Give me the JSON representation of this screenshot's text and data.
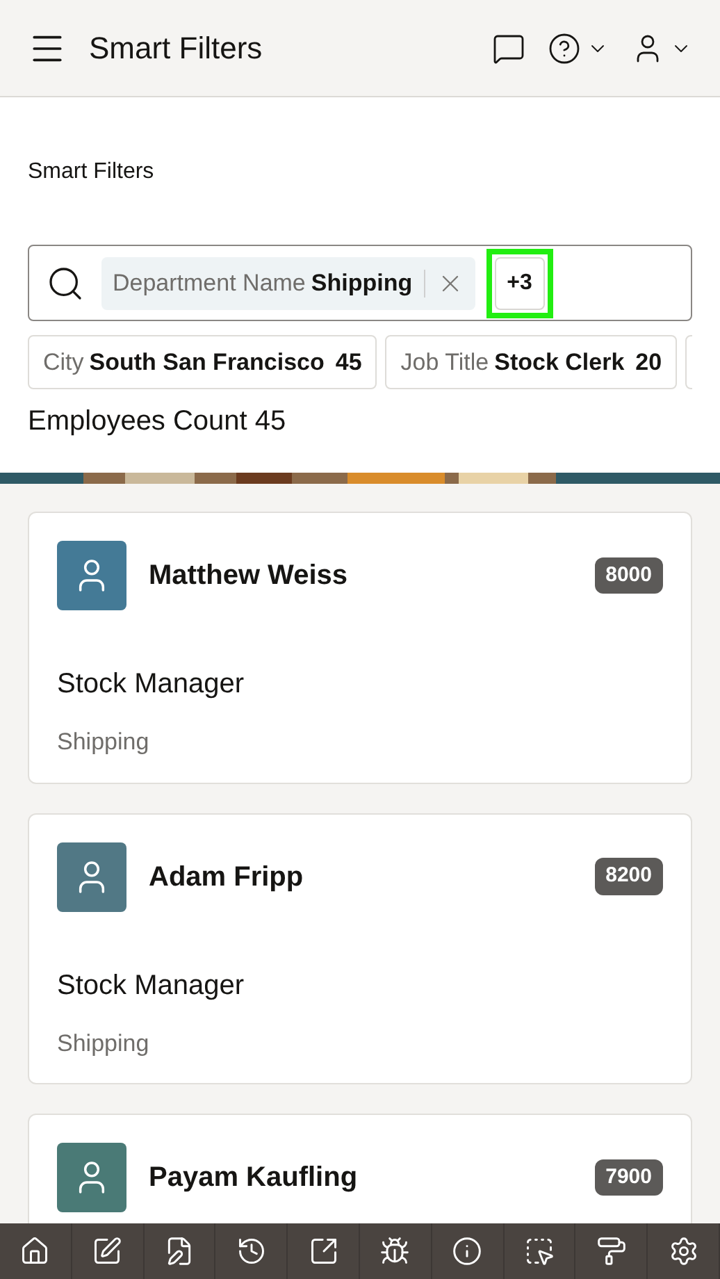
{
  "header": {
    "title": "Smart Filters"
  },
  "region_title": "Smart Filters",
  "search": {
    "chips": [
      {
        "label": "Department Name",
        "value": "Shipping"
      }
    ],
    "more": {
      "label": "+3",
      "highlighted": true
    }
  },
  "facets": [
    {
      "label": "City",
      "value": "South San Francisco",
      "count": "45"
    },
    {
      "label": "Job Title",
      "value": "Stock Clerk",
      "count": "20"
    }
  ],
  "count_label": "Employees Count 45",
  "employees": [
    {
      "name": "Matthew Weiss",
      "salary": "8000",
      "job": "Stock Manager",
      "department": "Shipping",
      "color": "#447a96"
    },
    {
      "name": "Adam Fripp",
      "salary": "8200",
      "job": "Stock Manager",
      "department": "Shipping",
      "color": "#517885"
    },
    {
      "name": "Payam Kaufling",
      "salary": "7900",
      "color": "#4a7a76"
    }
  ],
  "toolbar": [
    {
      "kind": "home"
    },
    {
      "kind": "edit"
    },
    {
      "kind": "edit-page"
    },
    {
      "kind": "history"
    },
    {
      "kind": "open"
    },
    {
      "kind": "debug"
    },
    {
      "kind": "info"
    },
    {
      "kind": "select"
    },
    {
      "kind": "theme"
    },
    {
      "kind": "settings"
    }
  ]
}
